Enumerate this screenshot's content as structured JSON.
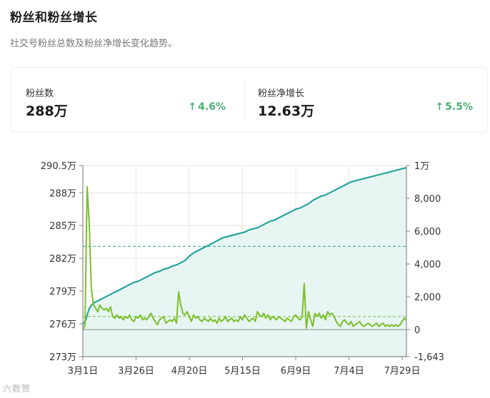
{
  "header": {
    "title": "粉丝和粉丝增长",
    "subtitle": "社交号粉丝总数及粉丝净增长变化趋势。"
  },
  "stats": [
    {
      "label": "粉丝数",
      "value": "288万",
      "change": "4.6%",
      "arrow": "↑"
    },
    {
      "label": "粉丝净增长",
      "value": "12.63万",
      "change": "5.5%",
      "arrow": "↑"
    }
  ],
  "watermark": "六数赞",
  "colors": {
    "followers_line": "#26a69a",
    "followers_area": "#e3f4f1",
    "growth_line": "#7cbf2a",
    "positive": "#4caf73"
  },
  "chart_data": {
    "type": "line",
    "x_tick_labels": [
      "3月1日",
      "3月26日",
      "4月20日",
      "5月15日",
      "6月9日",
      "7月4日",
      "7月29日"
    ],
    "x_range": [
      "3月1日",
      "7月31日"
    ],
    "left_axis": {
      "ticks": [
        "273万",
        "276万",
        "279万",
        "282万",
        "285万",
        "288万",
        "290.5万"
      ],
      "range": [
        273,
        290.5
      ],
      "unit": "万"
    },
    "right_axis": {
      "ticks": [
        "-1,643",
        "0",
        "2,000",
        "4,000",
        "6,000",
        "8,000",
        "1万"
      ],
      "range": [
        -1643,
        10000
      ]
    },
    "series": [
      {
        "axis": "left",
        "area": true,
        "reference_line": 283.1,
        "points": [
          [
            0,
            276.0
          ],
          [
            1,
            276.2
          ],
          [
            2,
            276.8
          ],
          [
            3,
            277.4
          ],
          [
            4,
            277.7
          ],
          [
            5,
            277.9
          ],
          [
            6,
            278.0
          ],
          [
            8,
            278.2
          ],
          [
            10,
            278.4
          ],
          [
            12,
            278.6
          ],
          [
            14,
            278.8
          ],
          [
            16,
            279.0
          ],
          [
            18,
            279.2
          ],
          [
            20,
            279.4
          ],
          [
            22,
            279.6
          ],
          [
            24,
            279.8
          ],
          [
            26,
            279.9
          ],
          [
            28,
            280.1
          ],
          [
            30,
            280.3
          ],
          [
            32,
            280.5
          ],
          [
            34,
            280.7
          ],
          [
            36,
            280.8
          ],
          [
            38,
            281.0
          ],
          [
            40,
            281.1
          ],
          [
            42,
            281.3
          ],
          [
            44,
            281.4
          ],
          [
            46,
            281.6
          ],
          [
            48,
            281.8
          ],
          [
            50,
            282.2
          ],
          [
            52,
            282.5
          ],
          [
            54,
            282.7
          ],
          [
            56,
            282.9
          ],
          [
            58,
            283.1
          ],
          [
            60,
            283.3
          ],
          [
            62,
            283.5
          ],
          [
            64,
            283.7
          ],
          [
            66,
            283.9
          ],
          [
            68,
            284.0
          ],
          [
            70,
            284.1
          ],
          [
            72,
            284.2
          ],
          [
            74,
            284.3
          ],
          [
            76,
            284.4
          ],
          [
            78,
            284.6
          ],
          [
            80,
            284.7
          ],
          [
            82,
            284.8
          ],
          [
            84,
            285.0
          ],
          [
            86,
            285.2
          ],
          [
            88,
            285.4
          ],
          [
            90,
            285.5
          ],
          [
            92,
            285.7
          ],
          [
            94,
            285.9
          ],
          [
            96,
            286.1
          ],
          [
            98,
            286.3
          ],
          [
            100,
            286.5
          ],
          [
            102,
            286.6
          ],
          [
            104,
            286.8
          ],
          [
            106,
            287.0
          ],
          [
            108,
            287.3
          ],
          [
            110,
            287.5
          ],
          [
            112,
            287.7
          ],
          [
            114,
            287.8
          ],
          [
            116,
            288.0
          ],
          [
            118,
            288.2
          ],
          [
            120,
            288.4
          ],
          [
            122,
            288.6
          ],
          [
            124,
            288.8
          ],
          [
            126,
            289.0
          ],
          [
            128,
            289.1
          ],
          [
            130,
            289.2
          ],
          [
            132,
            289.3
          ],
          [
            134,
            289.4
          ],
          [
            136,
            289.5
          ],
          [
            138,
            289.6
          ],
          [
            140,
            289.7
          ],
          [
            142,
            289.8
          ],
          [
            144,
            289.9
          ],
          [
            146,
            290.0
          ],
          [
            148,
            290.1
          ],
          [
            150,
            290.2
          ],
          [
            152,
            290.3
          ]
        ]
      },
      {
        "axis": "right",
        "reference_line": 800,
        "points": [
          [
            0,
            0
          ],
          [
            1,
            300
          ],
          [
            2,
            8700
          ],
          [
            3,
            6500
          ],
          [
            4,
            2500
          ],
          [
            5,
            1500
          ],
          [
            6,
            1300
          ],
          [
            7,
            1100
          ],
          [
            8,
            1500
          ],
          [
            9,
            1300
          ],
          [
            10,
            1200
          ],
          [
            11,
            1300
          ],
          [
            12,
            1100
          ],
          [
            13,
            1400
          ],
          [
            14,
            800
          ],
          [
            15,
            700
          ],
          [
            16,
            900
          ],
          [
            17,
            700
          ],
          [
            18,
            800
          ],
          [
            19,
            600
          ],
          [
            20,
            800
          ],
          [
            21,
            700
          ],
          [
            22,
            900
          ],
          [
            23,
            600
          ],
          [
            24,
            500
          ],
          [
            25,
            800
          ],
          [
            26,
            700
          ],
          [
            27,
            900
          ],
          [
            28,
            600
          ],
          [
            29,
            700
          ],
          [
            30,
            600
          ],
          [
            31,
            800
          ],
          [
            32,
            1000
          ],
          [
            33,
            700
          ],
          [
            34,
            500
          ],
          [
            35,
            300
          ],
          [
            36,
            600
          ],
          [
            37,
            700
          ],
          [
            38,
            800
          ],
          [
            39,
            400
          ],
          [
            40,
            500
          ],
          [
            41,
            600
          ],
          [
            42,
            500
          ],
          [
            43,
            700
          ],
          [
            44,
            400
          ],
          [
            45,
            2300
          ],
          [
            46,
            1500
          ],
          [
            47,
            1000
          ],
          [
            48,
            900
          ],
          [
            49,
            1100
          ],
          [
            50,
            800
          ],
          [
            51,
            500
          ],
          [
            52,
            900
          ],
          [
            53,
            700
          ],
          [
            54,
            800
          ],
          [
            55,
            600
          ],
          [
            56,
            500
          ],
          [
            57,
            700
          ],
          [
            58,
            600
          ],
          [
            59,
            500
          ],
          [
            60,
            700
          ],
          [
            61,
            500
          ],
          [
            62,
            600
          ],
          [
            63,
            400
          ],
          [
            64,
            700
          ],
          [
            65,
            500
          ],
          [
            66,
            600
          ],
          [
            67,
            800
          ],
          [
            68,
            500
          ],
          [
            69,
            600
          ],
          [
            70,
            700
          ],
          [
            71,
            500
          ],
          [
            72,
            600
          ],
          [
            73,
            500
          ],
          [
            74,
            800
          ],
          [
            75,
            600
          ],
          [
            76,
            900
          ],
          [
            77,
            700
          ],
          [
            78,
            500
          ],
          [
            79,
            600
          ],
          [
            80,
            700
          ],
          [
            81,
            500
          ],
          [
            82,
            1100
          ],
          [
            83,
            900
          ],
          [
            84,
            800
          ],
          [
            85,
            1000
          ],
          [
            86,
            700
          ],
          [
            87,
            900
          ],
          [
            88,
            600
          ],
          [
            89,
            800
          ],
          [
            90,
            700
          ],
          [
            91,
            600
          ],
          [
            92,
            800
          ],
          [
            93,
            700
          ],
          [
            94,
            600
          ],
          [
            95,
            500
          ],
          [
            96,
            700
          ],
          [
            97,
            600
          ],
          [
            98,
            500
          ],
          [
            99,
            800
          ],
          [
            100,
            900
          ],
          [
            101,
            700
          ],
          [
            102,
            600
          ],
          [
            103,
            800
          ],
          [
            104,
            2800
          ],
          [
            105,
            100
          ],
          [
            106,
            1100
          ],
          [
            107,
            600
          ],
          [
            108,
            200
          ],
          [
            109,
            1000
          ],
          [
            110,
            800
          ],
          [
            111,
            1000
          ],
          [
            112,
            700
          ],
          [
            113,
            900
          ],
          [
            114,
            600
          ],
          [
            115,
            1100
          ],
          [
            116,
            900
          ],
          [
            117,
            1000
          ],
          [
            118,
            800
          ],
          [
            119,
            500
          ],
          [
            120,
            300
          ],
          [
            121,
            200
          ],
          [
            122,
            500
          ],
          [
            123,
            600
          ],
          [
            124,
            400
          ],
          [
            125,
            300
          ],
          [
            126,
            500
          ],
          [
            127,
            200
          ],
          [
            128,
            300
          ],
          [
            129,
            400
          ],
          [
            130,
            500
          ],
          [
            131,
            300
          ],
          [
            132,
            200
          ],
          [
            133,
            300
          ],
          [
            134,
            400
          ],
          [
            135,
            300
          ],
          [
            136,
            200
          ],
          [
            137,
            300
          ],
          [
            138,
            400
          ],
          [
            139,
            200
          ],
          [
            140,
            300
          ],
          [
            141,
            400
          ],
          [
            142,
            200
          ],
          [
            143,
            300
          ],
          [
            144,
            200
          ],
          [
            145,
            300
          ],
          [
            146,
            200
          ],
          [
            147,
            300
          ],
          [
            148,
            200
          ],
          [
            149,
            300
          ],
          [
            150,
            500
          ],
          [
            151,
            700
          ],
          [
            152,
            600
          ]
        ]
      }
    ],
    "grid": true
  }
}
